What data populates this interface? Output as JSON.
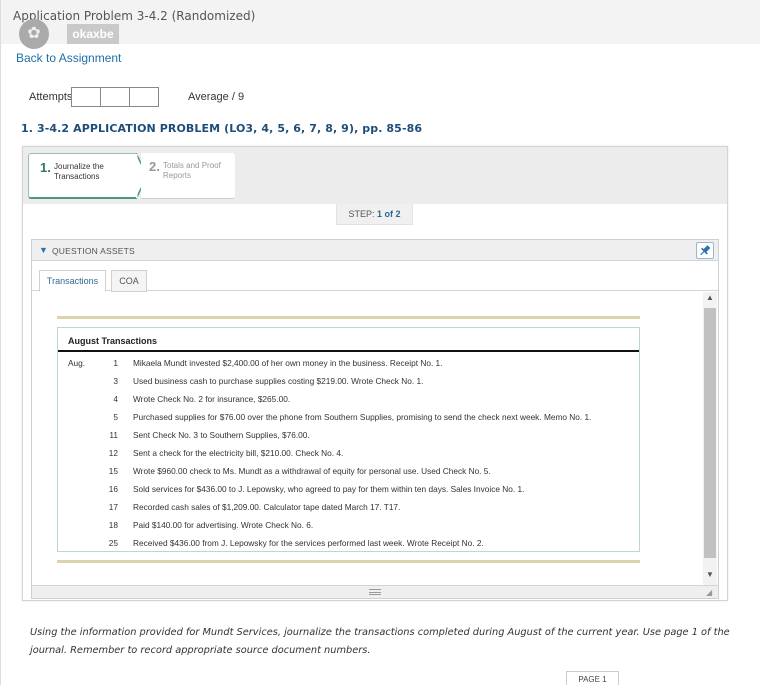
{
  "header": {
    "app_title": "Application Problem 3-4.2 (Randomized)",
    "user_badge": "okaxbe",
    "back_link": "Back to Assignment"
  },
  "attempts": {
    "label": "Attempts",
    "average_label": "Average / 9"
  },
  "problem": {
    "heading": "1. 3-4.2 APPLICATION PROBLEM (LO3, 4, 5, 6, 7, 8, 9), pp. 85-86"
  },
  "steps": {
    "tabs": [
      {
        "num": "1.",
        "label": "Journalize the Transactions",
        "active": true
      },
      {
        "num": "2.",
        "label": "Totals and Proof Reports",
        "active": false
      }
    ],
    "indicator_prefix": "STEP: ",
    "indicator_value": "1 of 2"
  },
  "assets": {
    "title": "QUESTION ASSETS",
    "tabs": [
      "Transactions",
      "COA"
    ],
    "transactions": {
      "title": "August Transactions",
      "rows": [
        {
          "month": "Aug.",
          "day": "1",
          "desc": "Mikaela Mundt invested $2,400.00 of her own money in the business. Receipt No. 1."
        },
        {
          "month": "",
          "day": "3",
          "desc": "Used business cash to purchase supplies costing $219.00. Wrote Check No. 1."
        },
        {
          "month": "",
          "day": "4",
          "desc": "Wrote Check No. 2 for insurance, $265.00."
        },
        {
          "month": "",
          "day": "5",
          "desc": "Purchased supplies for $76.00 over the phone from Southern Supplies, promising to send the check next week. Memo No. 1."
        },
        {
          "month": "",
          "day": "11",
          "desc": "Sent Check No. 3 to Southern Supplies, $76.00."
        },
        {
          "month": "",
          "day": "12",
          "desc": "Sent a check for the electricity bill, $210.00. Check No. 4."
        },
        {
          "month": "",
          "day": "15",
          "desc": "Wrote $960.00 check to Ms. Mundt as a withdrawal of equity for personal use. Used Check No. 5."
        },
        {
          "month": "",
          "day": "16",
          "desc": "Sold services for $436.00 to J. Lepowsky, who agreed to pay for them within ten days. Sales Invoice No. 1."
        },
        {
          "month": "",
          "day": "17",
          "desc": "Recorded cash sales of $1,209.00. Calculator tape dated March 17. T17."
        },
        {
          "month": "",
          "day": "18",
          "desc": "Paid $140.00 for advertising. Wrote Check No. 6."
        },
        {
          "month": "",
          "day": "25",
          "desc": "Received $436.00 from J. Lepowsky for the services performed last week. Wrote Receipt No. 2."
        }
      ]
    }
  },
  "instructions": "Using the information provided for Mundt Services, journalize the transactions completed during August of the current year. Use page 1 of the journal. Remember to record appropriate source document numbers.",
  "page_tab": "PAGE 1",
  "colors": {
    "link": "#1f6fa8",
    "heading": "#1e4d7a",
    "active_step": "#2c7a5b",
    "accent_rule": "#dcd2ab"
  },
  "icons": {
    "avatar": "user-avatar-icon",
    "caret": "caret-down-icon",
    "pin": "pin-icon"
  }
}
